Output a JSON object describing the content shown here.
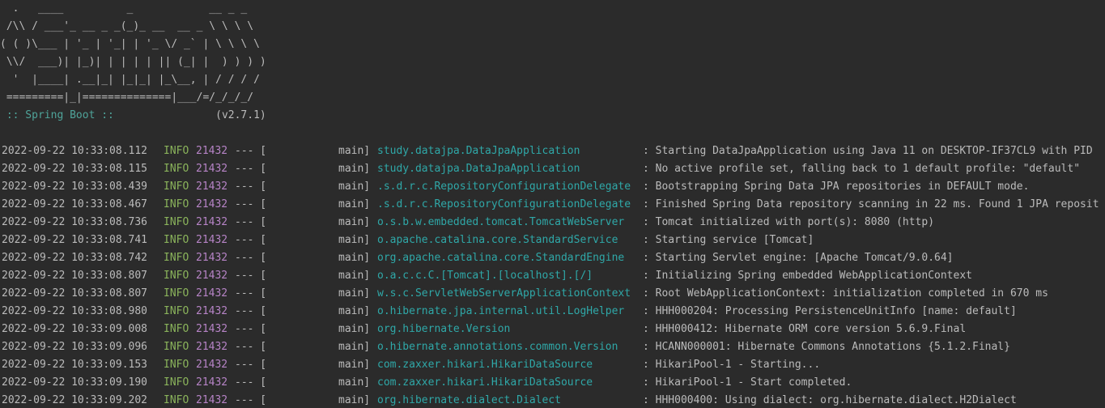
{
  "banner": {
    "lines": [
      "  .   ____          _            __ _ _",
      " /\\\\ / ___'_ __ _ _(_)_ __  __ _ \\ \\ \\ \\",
      "( ( )\\___ | '_ | '_| | '_ \\/ _` | \\ \\ \\ \\",
      " \\\\/  ___)| |_)| | | | | || (_| |  ) ) ) )",
      "  '  |____| .__|_| |_|_| |_\\__, | / / / /",
      " =========|_|==============|___/=/_/_/_/"
    ],
    "boot_label": " :: Spring Boot :: ",
    "boot_version": "               (v2.7.1)"
  },
  "log": [
    {
      "ts": "2022-09-22 10:33:08.112",
      "level": "INFO",
      "pid": "21432",
      "sep": "--- [",
      "thread": "main]",
      "logger": "study.datajpa.DataJpaApplication",
      "msg": ": Starting DataJpaApplication using Java 11 on DESKTOP-IF37CL9 with PID"
    },
    {
      "ts": "2022-09-22 10:33:08.115",
      "level": "INFO",
      "pid": "21432",
      "sep": "--- [",
      "thread": "main]",
      "logger": "study.datajpa.DataJpaApplication",
      "msg": ": No active profile set, falling back to 1 default profile: \"default\""
    },
    {
      "ts": "2022-09-22 10:33:08.439",
      "level": "INFO",
      "pid": "21432",
      "sep": "--- [",
      "thread": "main]",
      "logger": ".s.d.r.c.RepositoryConfigurationDelegate",
      "msg": ": Bootstrapping Spring Data JPA repositories in DEFAULT mode."
    },
    {
      "ts": "2022-09-22 10:33:08.467",
      "level": "INFO",
      "pid": "21432",
      "sep": "--- [",
      "thread": "main]",
      "logger": ".s.d.r.c.RepositoryConfigurationDelegate",
      "msg": ": Finished Spring Data repository scanning in 22 ms. Found 1 JPA reposit"
    },
    {
      "ts": "2022-09-22 10:33:08.736",
      "level": "INFO",
      "pid": "21432",
      "sep": "--- [",
      "thread": "main]",
      "logger": "o.s.b.w.embedded.tomcat.TomcatWebServer",
      "msg": ": Tomcat initialized with port(s): 8080 (http)"
    },
    {
      "ts": "2022-09-22 10:33:08.741",
      "level": "INFO",
      "pid": "21432",
      "sep": "--- [",
      "thread": "main]",
      "logger": "o.apache.catalina.core.StandardService",
      "msg": ": Starting service [Tomcat]"
    },
    {
      "ts": "2022-09-22 10:33:08.742",
      "level": "INFO",
      "pid": "21432",
      "sep": "--- [",
      "thread": "main]",
      "logger": "org.apache.catalina.core.StandardEngine",
      "msg": ": Starting Servlet engine: [Apache Tomcat/9.0.64]"
    },
    {
      "ts": "2022-09-22 10:33:08.807",
      "level": "INFO",
      "pid": "21432",
      "sep": "--- [",
      "thread": "main]",
      "logger": "o.a.c.c.C.[Tomcat].[localhost].[/]",
      "msg": ": Initializing Spring embedded WebApplicationContext"
    },
    {
      "ts": "2022-09-22 10:33:08.807",
      "level": "INFO",
      "pid": "21432",
      "sep": "--- [",
      "thread": "main]",
      "logger": "w.s.c.ServletWebServerApplicationContext",
      "msg": ": Root WebApplicationContext: initialization completed in 670 ms"
    },
    {
      "ts": "2022-09-22 10:33:08.980",
      "level": "INFO",
      "pid": "21432",
      "sep": "--- [",
      "thread": "main]",
      "logger": "o.hibernate.jpa.internal.util.LogHelper",
      "msg": ": HHH000204: Processing PersistenceUnitInfo [name: default]"
    },
    {
      "ts": "2022-09-22 10:33:09.008",
      "level": "INFO",
      "pid": "21432",
      "sep": "--- [",
      "thread": "main]",
      "logger": "org.hibernate.Version",
      "msg": ": HHH000412: Hibernate ORM core version 5.6.9.Final"
    },
    {
      "ts": "2022-09-22 10:33:09.096",
      "level": "INFO",
      "pid": "21432",
      "sep": "--- [",
      "thread": "main]",
      "logger": "o.hibernate.annotations.common.Version",
      "msg": ": HCANN000001: Hibernate Commons Annotations {5.1.2.Final}"
    },
    {
      "ts": "2022-09-22 10:33:09.153",
      "level": "INFO",
      "pid": "21432",
      "sep": "--- [",
      "thread": "main]",
      "logger": "com.zaxxer.hikari.HikariDataSource",
      "msg": ": HikariPool-1 - Starting..."
    },
    {
      "ts": "2022-09-22 10:33:09.190",
      "level": "INFO",
      "pid": "21432",
      "sep": "--- [",
      "thread": "main]",
      "logger": "com.zaxxer.hikari.HikariDataSource",
      "msg": ": HikariPool-1 - Start completed."
    },
    {
      "ts": "2022-09-22 10:33:09.202",
      "level": "INFO",
      "pid": "21432",
      "sep": "--- [",
      "thread": "main]",
      "logger": "org.hibernate.dialect.Dialect",
      "msg": ": HHH000400: Using dialect: org.hibernate.dialect.H2Dialect"
    }
  ],
  "colors": {
    "background": "#2b2b2b",
    "text": "#bbbbbb",
    "info_level": "#8ab35b",
    "pid": "#b784c7",
    "logger": "#2fa8a8",
    "boot_label": "#4fa49a"
  }
}
